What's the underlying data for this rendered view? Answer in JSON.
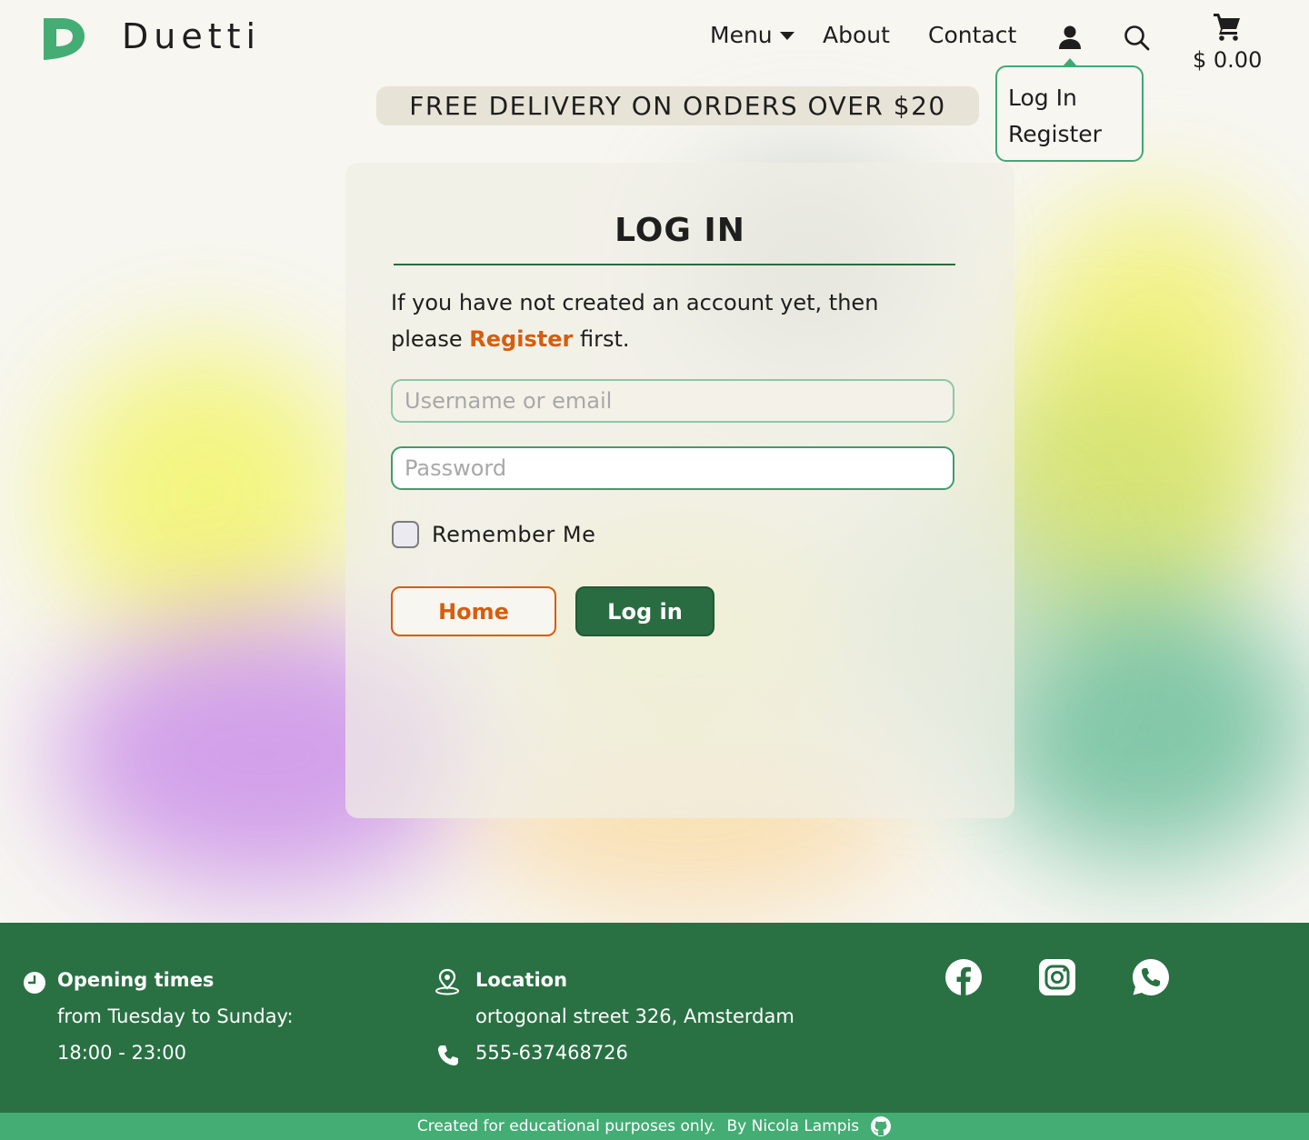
{
  "header": {
    "brand": "Duetti",
    "nav": {
      "menu": "Menu",
      "about": "About",
      "contact": "Contact"
    },
    "cart_total": "$ 0.00",
    "icons": [
      "logo-icon",
      "user-icon",
      "search-icon",
      "cart-icon"
    ]
  },
  "account_dropdown": {
    "items": [
      "Log In",
      "Register"
    ]
  },
  "banner": {
    "text": "FREE DELIVERY ON ORDERS OVER $20"
  },
  "login": {
    "title": "LOG IN",
    "intro_before": "If you have not created an account yet, then please ",
    "intro_link": "Register",
    "intro_after": " first.",
    "username_placeholder": "Username or email",
    "password_placeholder": "Password",
    "remember_label": "Remember Me",
    "home_button": "Home",
    "login_button": "Log in"
  },
  "footer": {
    "opening": {
      "title": "Opening times",
      "line1": "from Tuesday to Sunday:",
      "line2": "18:00 - 23:00"
    },
    "location": {
      "title": "Location",
      "address": "ortogonal street 326, Amsterdam",
      "phone": "555-637468726"
    },
    "social": [
      "facebook-icon",
      "instagram-icon",
      "whatsapp-icon"
    ],
    "credit_left": "Created for educational purposes only.",
    "credit_right": "By Nicola Lampis"
  },
  "colors": {
    "primary_green": "#297143",
    "accent_green": "#43ad74",
    "orange": "#d65d0e",
    "background": "#f7f6f1"
  }
}
